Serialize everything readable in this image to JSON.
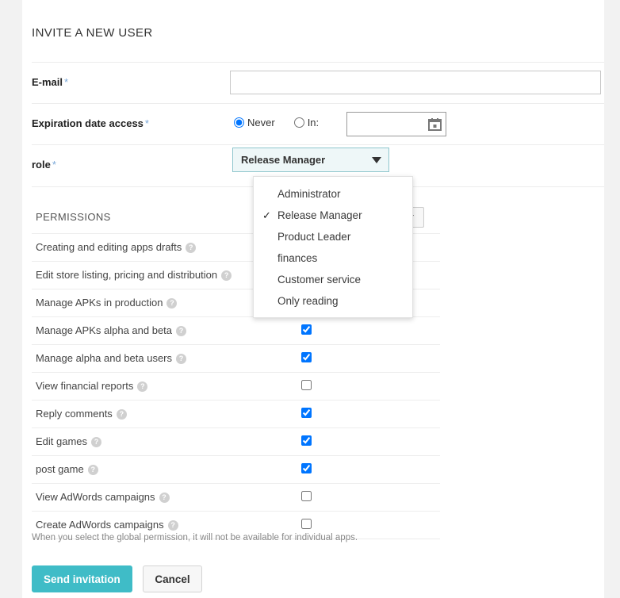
{
  "page": {
    "title": "INVITE A NEW USER"
  },
  "form": {
    "email": {
      "label": "E-mail",
      "required_marker": "*",
      "value": "",
      "placeholder": ""
    },
    "expiration": {
      "label": "Expiration date access",
      "required_marker": "*",
      "options": [
        {
          "label": "Never",
          "selected": true
        },
        {
          "label": "In:",
          "selected": false
        }
      ],
      "date_value": "",
      "date_placeholder": "",
      "calendar_icon": "calendar-icon"
    },
    "role": {
      "label": "role",
      "required_marker": "*",
      "selected": "Release Manager",
      "arrow_icon": "chevron-down-icon",
      "options": [
        {
          "label": "Administrator",
          "checked": false
        },
        {
          "label": "Release Manager",
          "checked": true
        },
        {
          "label": "Product Leader",
          "checked": false
        },
        {
          "label": "finances",
          "checked": false
        },
        {
          "label": "Customer service",
          "checked": false
        },
        {
          "label": "Only reading",
          "checked": false
        }
      ],
      "check_glyph": "✓"
    }
  },
  "permissions": {
    "header": "PERMISSIONS",
    "header_select_icon": "chevron-down-icon",
    "help_glyph": "?",
    "rows": [
      {
        "label": "Creating and editing apps drafts",
        "checked": false
      },
      {
        "label": "Edit store listing, pricing and distribution",
        "checked": false
      },
      {
        "label": "Manage APKs in production",
        "checked": false
      },
      {
        "label": "Manage APKs alpha and beta",
        "checked": true
      },
      {
        "label": "Manage alpha and beta users",
        "checked": true
      },
      {
        "label": "View financial reports",
        "checked": false
      },
      {
        "label": "Reply comments",
        "checked": true
      },
      {
        "label": "Edit games",
        "checked": true
      },
      {
        "label": "post game",
        "checked": true
      },
      {
        "label": "View AdWords campaigns",
        "checked": false
      },
      {
        "label": "Create AdWords campaigns",
        "checked": false
      }
    ],
    "note": "When you select the global permission, it will not be available for individual apps."
  },
  "actions": {
    "submit_label": "Send invitation",
    "cancel_label": "Cancel"
  },
  "colors": {
    "accent": "#3fbcc7",
    "select_border": "#8fc6cd",
    "select_bg": "#eef7f8",
    "required": "#7aa8d8"
  }
}
